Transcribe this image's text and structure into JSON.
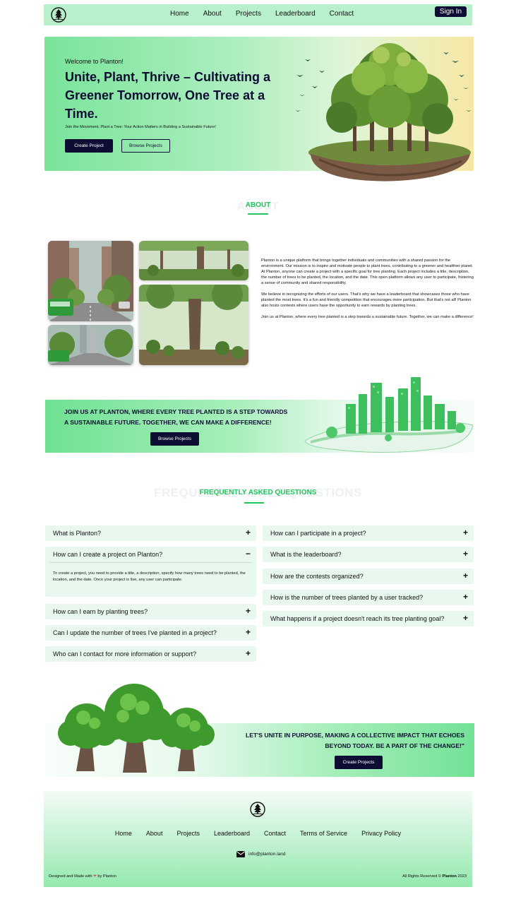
{
  "nav": {
    "links": [
      "Home",
      "About",
      "Projects",
      "Leaderboard",
      "Contact"
    ],
    "signin_label": "Sign In",
    "logo_icon": "tree-circle-logo-icon"
  },
  "hero": {
    "kicker": "Welcome to Planton!",
    "title": "Unite, Plant, Thrive – Cultivating a Greener Tomorrow, One Tree at a Time.",
    "subtitle": "Join the Movement, Plant a Tree: Your Action Matters in Building a Sustainable Future!",
    "primary_button": "Create Project",
    "secondary_button": "Browse Projects"
  },
  "about": {
    "ghost_heading": "ABOUT",
    "heading": "ABOUT",
    "paragraphs": [
      "Planton is a unique platform that brings together individuals and communities with a shared passion for the environment. Our mission is to inspire and motivate people to plant trees, contributing to a greener and healthier planet. At Planton, anyone can create a project with a specific goal for tree planting. Each project includes a title, description, the number of trees to be planted, the location, and the date. This open platform allows any user to participate, fostering a sense of community and shared responsibility.",
      "We believe in recognizing the efforts of our users. That's why we have a leaderboard that showcases those who have planted the most trees. It's a fun and friendly competition that encourages more participation. But that's not all! Planton also hosts contests where users have the opportunity to earn rewards by planting trees.",
      "Join us at Planton, where every tree planted is a step towards a sustainable future. Together, we can make a difference!"
    ]
  },
  "join_banner": {
    "title": "JOIN US AT PLANTON, WHERE EVERY TREE PLANTED IS A STEP TOWARDS A SUSTAINABLE FUTURE. TOGETHER, WE CAN MAKE A DIFFERENCE!",
    "button": "Browse Projects"
  },
  "faq": {
    "ghost_heading": "FREQUENTLY ASKED QUESTIONS",
    "heading": "FREQUENTLY ASKED QUESTIONS",
    "left": [
      "What is Planton?",
      "How can I create a project on Planton?",
      "How can I earn by planting trees?",
      "Can I update the number of trees I've planted in a project?",
      "Who can I contact for more information or support?"
    ],
    "right": [
      "How can I participate in a project?",
      "What is the leaderboard?",
      "How are the contests organized?",
      "How is the number of trees planted by a user tracked?",
      "What happens if a project doesn't reach its tree planting goal?"
    ],
    "open_answer": "To create a project, you need to provide a title, a description, specify how many trees need to be planted, the location, and the date. Once your project is live, any user can participate.",
    "plus": "+",
    "minus": "−"
  },
  "unite_banner": {
    "title": "LET'S UNITE IN PURPOSE, MAKING A COLLECTIVE IMPACT THAT ECHOES BEYOND TODAY. BE A PART OF THE CHANGE!\"",
    "button": "Create Projects"
  },
  "footer": {
    "links": [
      "Home",
      "About",
      "Projects",
      "Leaderboard",
      "Contact",
      "Terms of Service",
      "Privacy Policy"
    ],
    "email": "info@planton.land",
    "made_prefix": "Designed and Made with",
    "made_suffix": "by Planton",
    "rights_prefix": "All Rights Reserved ©",
    "rights_brand": "Planton",
    "rights_year": "2023"
  },
  "colors": {
    "accent": "#22c55e",
    "dark": "#0d0d33",
    "mint": "#b9f0cc"
  }
}
